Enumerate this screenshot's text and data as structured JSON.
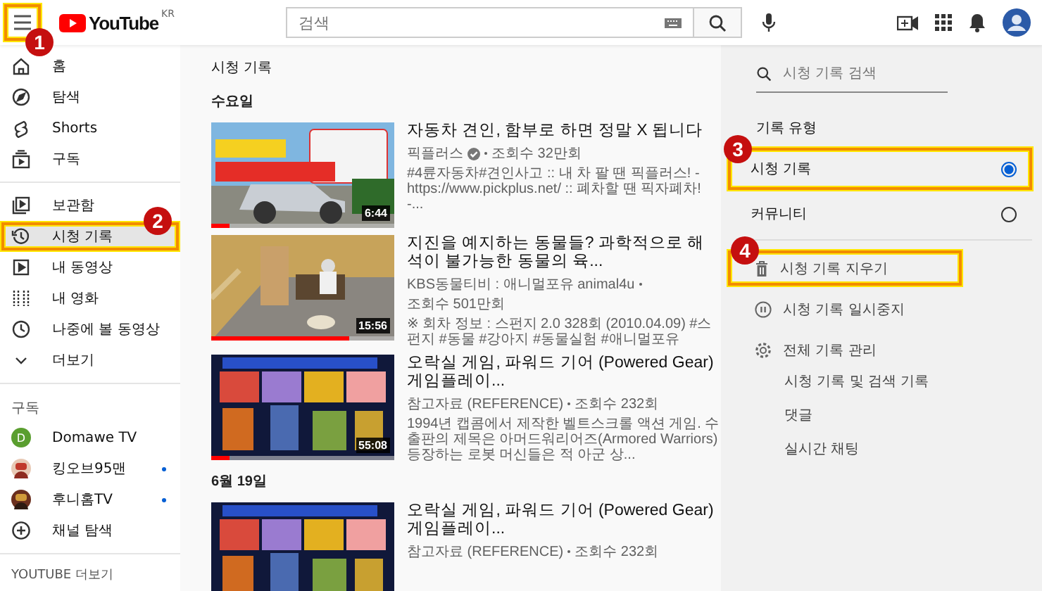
{
  "header": {
    "menu_callout": "1",
    "logo": "YouTube",
    "region": "KR",
    "search": {
      "placeholder": "검색"
    }
  },
  "sidebar": {
    "sections": [
      {
        "items": [
          {
            "label": "홈",
            "selected": false
          },
          {
            "label": "탐색",
            "selected": false
          },
          {
            "label": "Shorts",
            "selected": false
          },
          {
            "label": "구독",
            "selected": false
          }
        ]
      },
      {
        "items": [
          {
            "label": "보관함",
            "selected": false
          },
          {
            "label": "시청 기록",
            "selected": true,
            "callout": "2"
          },
          {
            "label": "내 동영상",
            "selected": false
          },
          {
            "label": "내 영화",
            "selected": false
          },
          {
            "label": "나중에 볼 동영상",
            "selected": false
          },
          {
            "label": "더보기",
            "selected": false
          }
        ]
      }
    ],
    "subscriptions": {
      "heading": "구독",
      "channels": [
        {
          "name": "Domawe TV",
          "kind": "letter",
          "letter": "D",
          "color": "#5a9e2f",
          "new": false
        },
        {
          "name": "킹오브95맨",
          "kind": "picture",
          "new": true
        },
        {
          "name": "후니홈TV",
          "kind": "picture",
          "new": true
        }
      ],
      "browse": "채널 탐색"
    },
    "more_heading": "YOUTUBE 더보기"
  },
  "main": {
    "title": "시청 기록",
    "groups": [
      {
        "date": "수요일",
        "videos": [
          {
            "title": "자동차 견인, 함부로 하면 정말 X 됩니다",
            "channel": "픽플러스",
            "verified": true,
            "views": "조회수 32만회",
            "description": "#4륜자동차#견인사고 :: 내 차 팔 땐 픽플러스! - https://www.pickplus.net/ :: 폐차할 땐 픽자폐차! -...",
            "duration": "6:44",
            "level": 0.1
          },
          {
            "title": "지진을 예지하는 동물들? 과학적으로 해석이 불가능한 동물의 육...",
            "channel": "KBS동물티비 : 애니멀포유 animal4u",
            "verified": false,
            "views": "조회수 501만회",
            "description": "※ 회차 정보 : 스펀지 2.0 328회 (2010.04.09) #스펀지 #동물 #강아지 #동물실험 #애니멀포유",
            "duration": "15:56",
            "level": 0.75
          },
          {
            "title": "오락실 게임, 파워드 기어 (Powered Gear) 게임플레이...",
            "channel": "참고자료 (REFERENCE)",
            "verified": false,
            "views": "조회수 232회",
            "description": "1994년 캡콤에서 제작한 벨트스크롤 액션 게임. 수출판의 제목은 아머드워리어즈(Armored Warriors) 등장하는 로봇 머신들은 적 아군 상...",
            "duration": "55:08",
            "level": 0.1
          }
        ]
      },
      {
        "date": "6월 19일",
        "videos": [
          {
            "title": "오락실 게임, 파워드 기어 (Powered Gear) 게임플레이...",
            "channel": "참고자료 (REFERENCE)",
            "verified": false,
            "views": "조회수 232회"
          }
        ]
      }
    ]
  },
  "panel": {
    "search": {
      "placeholder": "시청 기록 검색"
    },
    "type_heading": "기록 유형",
    "types": [
      {
        "label": "시청 기록",
        "selected": true,
        "callout": "3"
      },
      {
        "label": "커뮤니티",
        "selected": false
      }
    ],
    "actions": [
      {
        "label": "시청 기록 지우기",
        "callout": "4"
      },
      {
        "label": "시청 기록 일시중지"
      },
      {
        "label": "전체 기록 관리"
      }
    ],
    "links": [
      "시청 기록 및 검색 기록",
      "댓글",
      "실시간 채팅"
    ]
  }
}
